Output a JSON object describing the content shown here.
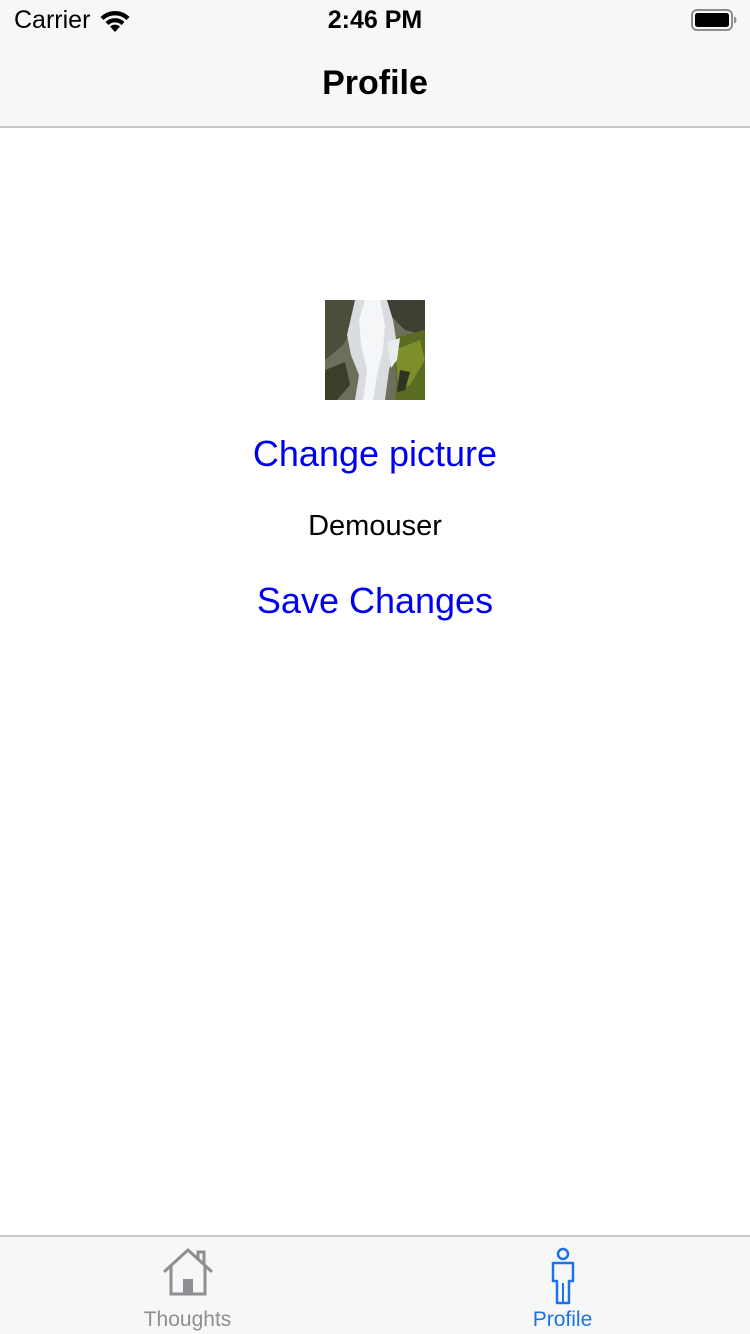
{
  "status_bar": {
    "carrier": "Carrier",
    "time": "2:46 PM",
    "wifi_icon": "wifi-icon",
    "battery_icon": "battery-icon"
  },
  "nav": {
    "title": "Profile"
  },
  "profile": {
    "avatar_icon": "waterfall-photo",
    "change_picture_label": "Change picture",
    "username": "Demouser",
    "save_label": "Save Changes"
  },
  "tab_bar": {
    "tabs": [
      {
        "label": "Thoughts",
        "icon": "house-icon",
        "selected": false
      },
      {
        "label": "Profile",
        "icon": "person-icon",
        "selected": true
      }
    ]
  },
  "colors": {
    "link": "#0000ee",
    "tab_selected": "#1a73e8",
    "tab_unselected": "#8e8e93",
    "bar_background": "#f7f7f7"
  }
}
